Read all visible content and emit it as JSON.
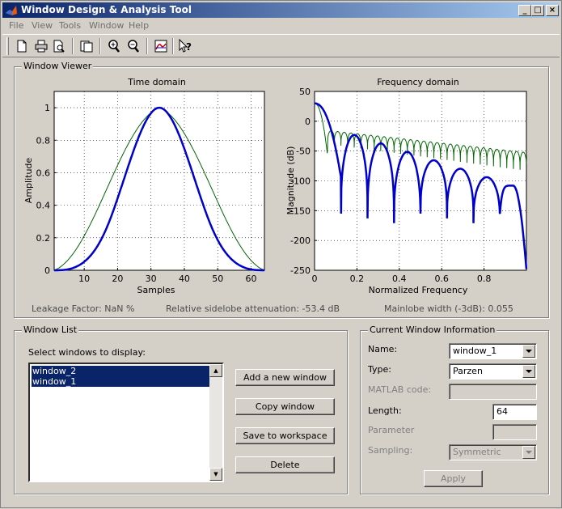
{
  "window": {
    "title": "Window Design & Analysis Tool",
    "min": "_",
    "max": "□",
    "close": "×"
  },
  "menu": [
    "File",
    "View",
    "Tools",
    "Window",
    "Help"
  ],
  "toolbar_icons": [
    "new-icon",
    "print-icon",
    "print-preview-icon",
    "new-figure-icon",
    "zoom-in-icon",
    "zoom-out-icon",
    "fvtool-icon",
    "whats-this-icon"
  ],
  "viewer": {
    "label": "Window Viewer",
    "leakage": "Leakage Factor: NaN %",
    "sidelobe": "Relative sidelobe attenuation: -53.4 dB",
    "mainlobe": "Mainlobe width (-3dB): 0.055"
  },
  "chart_data": [
    {
      "type": "line",
      "title": "Time domain",
      "xlabel": "Samples",
      "ylabel": "Amplitude",
      "xlim": [
        1,
        64
      ],
      "ylim": [
        0,
        1.1
      ],
      "xticks": [
        10,
        20,
        30,
        40,
        50,
        60
      ],
      "yticks": [
        0,
        0.2,
        0.4,
        0.6,
        0.8,
        1
      ],
      "series": [
        {
          "color": "#0000cc",
          "shape": "parzen",
          "length": 64,
          "peak_at": 32.5,
          "peak": 1
        },
        {
          "color": "#006600",
          "shape": "bartlett-hann",
          "length": 64,
          "peak_at": 32.5,
          "peak": 1
        }
      ]
    },
    {
      "type": "line",
      "title": "Frequency domain",
      "xlabel": "Normalized Frequency",
      "ylabel": "Magnitude (dB)",
      "xlim": [
        0,
        1
      ],
      "ylim": [
        -250,
        50
      ],
      "xticks": [
        0,
        0.2,
        0.4,
        0.6,
        0.8
      ],
      "yticks": [
        50,
        0,
        -50,
        -100,
        -150,
        -200,
        -250
      ],
      "series": [
        {
          "color": "#0000cc",
          "start_db": 30,
          "first_lobe_db": -23,
          "last_lobe_db": -108,
          "nulls": [
            0.125,
            0.25,
            0.375,
            0.5,
            0.625,
            0.75,
            0.875
          ]
        },
        {
          "color": "#006600",
          "start_db": 30,
          "first_lobe_db": -16,
          "last_lobe_db": -53,
          "nulls_spacing": 0.0313
        }
      ]
    }
  ],
  "window_list": {
    "label": "Window List",
    "prompt": "Select windows to display:",
    "items": [
      "window_2",
      "window_1"
    ],
    "add": "Add a new window",
    "copy": "Copy window",
    "save": "Save to workspace",
    "delete": "Delete"
  },
  "current": {
    "label": "Current Window Information",
    "name_label": "Name:",
    "name_value": "window_1",
    "type_label": "Type:",
    "type_value": "Parzen",
    "matlab_label": "MATLAB code:",
    "matlab_value": "",
    "length_label": "Length:",
    "length_value": "64",
    "param_label": "Parameter",
    "param_value": "",
    "sampling_label": "Sampling:",
    "sampling_value": "Symmetric",
    "apply": "Apply"
  }
}
